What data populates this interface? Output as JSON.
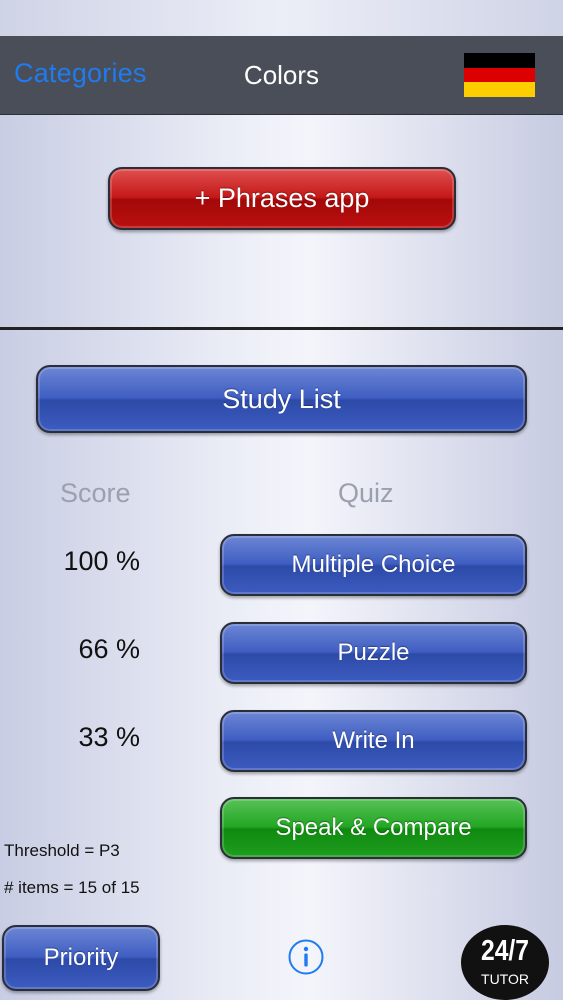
{
  "nav": {
    "back_label": "Categories",
    "title": "Colors",
    "flag": {
      "name": "germany-flag-icon",
      "colors": [
        "#000000",
        "#dd0000",
        "#ffce00"
      ]
    }
  },
  "promo": {
    "phrases_label": "+ Phrases app"
  },
  "study": {
    "study_list_label": "Study List"
  },
  "headers": {
    "score": "Score",
    "quiz": "Quiz"
  },
  "quiz_rows": [
    {
      "score": "100 %",
      "label": "Multiple Choice"
    },
    {
      "score": "66 %",
      "label": "Puzzle"
    },
    {
      "score": "33 %",
      "label": "Write In"
    },
    {
      "score": "",
      "label": "Speak & Compare"
    }
  ],
  "info": {
    "threshold": "Threshold  =  P3",
    "items": "# items =  15  of  15"
  },
  "footer": {
    "priority_label": "Priority",
    "info_icon": "info-icon",
    "tutor_top": "24/7",
    "tutor_bottom": "TUTOR"
  },
  "colors": {
    "nav_bg": "#4a4e58",
    "link_blue": "#1e7bf0",
    "red_button": "#c41818",
    "blue_button": "#3f5ec2",
    "green_button": "#23a623"
  }
}
